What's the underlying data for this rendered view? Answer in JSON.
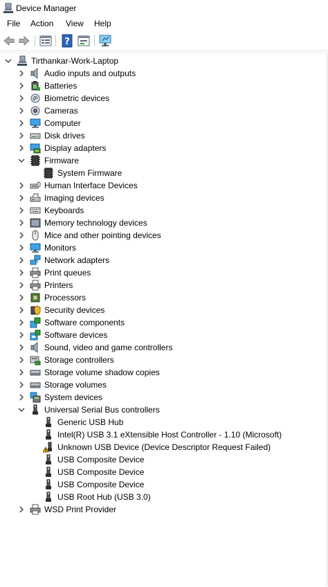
{
  "window": {
    "title": "Device Manager",
    "icon": "device-manager-icon"
  },
  "menu": [
    "File",
    "Action",
    "View",
    "Help"
  ],
  "toolbar": [
    "back-arrow-icon",
    "forward-arrow-icon",
    "properties-icon",
    "help-icon",
    "update-driver-icon",
    "scan-hardware-icon"
  ],
  "tree": {
    "root": "Tirthankar-Work-Laptop",
    "items": [
      {
        "label": "Audio inputs and outputs",
        "icon": "speaker-icon",
        "state": "collapsed"
      },
      {
        "label": "Batteries",
        "icon": "battery-icon",
        "state": "collapsed"
      },
      {
        "label": "Biometric devices",
        "icon": "fingerprint-icon",
        "state": "collapsed"
      },
      {
        "label": "Cameras",
        "icon": "camera-icon",
        "state": "collapsed"
      },
      {
        "label": "Computer",
        "icon": "monitor-icon",
        "state": "collapsed"
      },
      {
        "label": "Disk drives",
        "icon": "disk-drive-icon",
        "state": "collapsed"
      },
      {
        "label": "Display adapters",
        "icon": "display-adapter-icon",
        "state": "collapsed"
      },
      {
        "label": "Firmware",
        "icon": "chip-icon",
        "state": "expanded"
      },
      {
        "label": "System Firmware",
        "icon": "chip-icon",
        "state": "child"
      },
      {
        "label": "Human Interface Devices",
        "icon": "hid-icon",
        "state": "collapsed"
      },
      {
        "label": "Imaging devices",
        "icon": "scanner-icon",
        "state": "collapsed"
      },
      {
        "label": "Keyboards",
        "icon": "keyboard-icon",
        "state": "collapsed"
      },
      {
        "label": "Memory technology devices",
        "icon": "memory-card-icon",
        "state": "collapsed"
      },
      {
        "label": "Mice and other pointing devices",
        "icon": "mouse-icon",
        "state": "collapsed"
      },
      {
        "label": "Monitors",
        "icon": "monitor-icon",
        "state": "collapsed"
      },
      {
        "label": "Network adapters",
        "icon": "network-icon",
        "state": "collapsed"
      },
      {
        "label": "Print queues",
        "icon": "printer-icon",
        "state": "collapsed"
      },
      {
        "label": "Printers",
        "icon": "printer-icon",
        "state": "collapsed"
      },
      {
        "label": "Processors",
        "icon": "processor-icon",
        "state": "collapsed"
      },
      {
        "label": "Security devices",
        "icon": "security-icon",
        "state": "collapsed"
      },
      {
        "label": "Software components",
        "icon": "software-component-icon",
        "state": "collapsed"
      },
      {
        "label": "Software devices",
        "icon": "software-device-icon",
        "state": "collapsed"
      },
      {
        "label": "Sound, video and game controllers",
        "icon": "speaker-icon",
        "state": "collapsed"
      },
      {
        "label": "Storage controllers",
        "icon": "storage-controller-icon",
        "state": "collapsed"
      },
      {
        "label": "Storage volume shadow copies",
        "icon": "drive-icon",
        "state": "collapsed"
      },
      {
        "label": "Storage volumes",
        "icon": "drive-icon",
        "state": "collapsed"
      },
      {
        "label": "System devices",
        "icon": "system-devices-icon",
        "state": "collapsed"
      },
      {
        "label": "Universal Serial Bus controllers",
        "icon": "usb-icon",
        "state": "expanded"
      },
      {
        "label": "Generic USB Hub",
        "icon": "usb-icon",
        "state": "child"
      },
      {
        "label": "Intel(R) USB 3.1 eXtensible Host Controller - 1.10 (Microsoft)",
        "icon": "usb-icon",
        "state": "child"
      },
      {
        "label": "Unknown USB Device (Device Descriptor Request Failed)",
        "icon": "usb-warning-icon",
        "state": "child"
      },
      {
        "label": "USB Composite Device",
        "icon": "usb-icon",
        "state": "child"
      },
      {
        "label": "USB Composite Device",
        "icon": "usb-icon",
        "state": "child"
      },
      {
        "label": "USB Composite Device",
        "icon": "usb-icon",
        "state": "child"
      },
      {
        "label": "USB Root Hub (USB 3.0)",
        "icon": "usb-icon",
        "state": "child"
      },
      {
        "label": "WSD Print Provider",
        "icon": "printer-icon",
        "state": "collapsed"
      }
    ]
  }
}
